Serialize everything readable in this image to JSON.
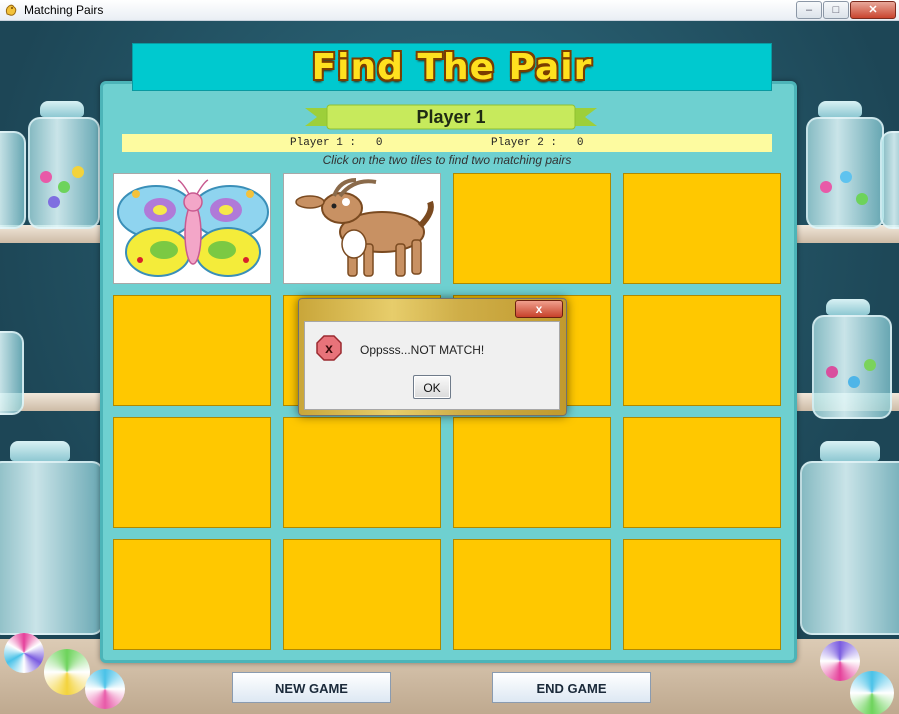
{
  "window": {
    "title": "Matching Pairs",
    "controls": {
      "minimize": "–",
      "maximize": "□",
      "close": "✕"
    }
  },
  "header": {
    "title": "Find The Pair"
  },
  "turn": {
    "label": "Player 1"
  },
  "scores": {
    "player1": "Player 1 :   0",
    "player2": "Player 2 :   0"
  },
  "instructions": "Click on the two tiles to find two matching pairs",
  "board": {
    "rows": 4,
    "cols": 4,
    "tiles": [
      {
        "state": "revealed",
        "icon": "butterfly-icon"
      },
      {
        "state": "revealed",
        "icon": "goat-icon"
      },
      {
        "state": "hidden"
      },
      {
        "state": "hidden"
      },
      {
        "state": "hidden"
      },
      {
        "state": "hidden"
      },
      {
        "state": "hidden"
      },
      {
        "state": "hidden"
      },
      {
        "state": "hidden"
      },
      {
        "state": "hidden"
      },
      {
        "state": "hidden"
      },
      {
        "state": "hidden"
      },
      {
        "state": "hidden"
      },
      {
        "state": "hidden"
      },
      {
        "state": "hidden"
      },
      {
        "state": "hidden"
      }
    ]
  },
  "dialog": {
    "message": "Oppsss...NOT MATCH!",
    "ok_label": "OK",
    "close_glyph": "x",
    "icon": "error-icon"
  },
  "buttons": {
    "new_game": "NEW GAME",
    "end_game": "END GAME"
  },
  "colors": {
    "tile_hidden": "#ffc800",
    "banner": "#00c9cf",
    "panel": "#6ed0d0",
    "title_text": "#ffe11f",
    "score_bar": "#fdfba0"
  }
}
